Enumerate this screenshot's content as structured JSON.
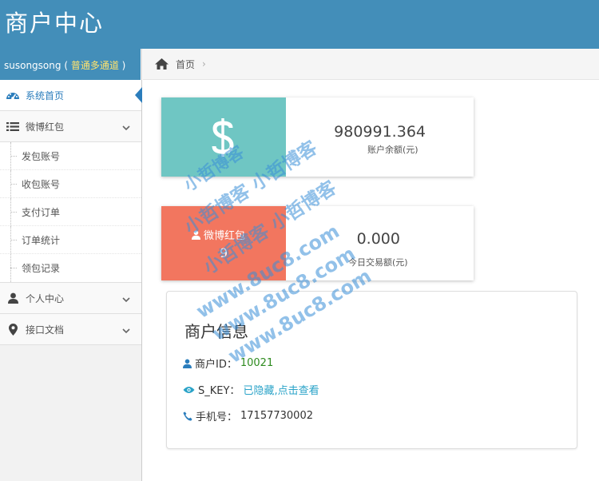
{
  "app": {
    "title": "商户中心"
  },
  "user": {
    "name": "susongsong",
    "paren_open": " ( ",
    "channel": "普通多通道",
    "paren_close": " )"
  },
  "nav": {
    "home": "系统首页",
    "weibo": "微博红包",
    "sub_items": [
      "发包账号",
      "收包账号",
      "支付订单",
      "订单统计",
      "领包记录"
    ],
    "personal": "个人中心",
    "api_docs": "接口文档"
  },
  "breadcrumb": {
    "home": "首页",
    "separator": "›"
  },
  "stats": {
    "balance": {
      "value": "980991.364",
      "caption": "账户余额(元)",
      "icon": "dollar-icon",
      "color": "#6fc6c3"
    },
    "weibo": {
      "label": "微博红包",
      "count": "9",
      "value": "0.000",
      "caption": "今日交易额(元)",
      "icon": "user-icon",
      "color": "#f2765f"
    }
  },
  "info": {
    "title": "商户信息",
    "merchant_id_label": "商户ID：",
    "merchant_id": "10021",
    "skey_label": "S_KEY：",
    "skey_value": "已隐藏,点击查看",
    "phone_label": "手机号：",
    "phone": "17157730002"
  },
  "watermark": {
    "line1": "小哲博客",
    "line2": "小哲博客 小哲博客",
    "line3": "小哲博客 小哲博客",
    "line4": "www.8uc8.com",
    "line5": "www.8uc8.com",
    "line6": "www.8uc8.com"
  },
  "colors": {
    "topbar": "#438eb9",
    "accent": "#2b7dbc",
    "green": "#2e8b1f",
    "cyan": "#2aa3c8"
  }
}
